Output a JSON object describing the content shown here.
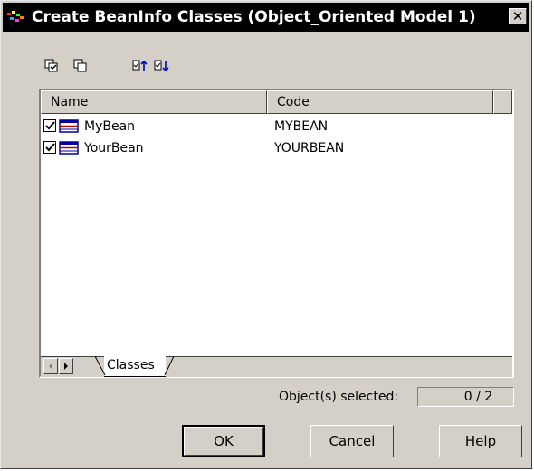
{
  "window": {
    "title": "Create BeanInfo Classes (Object_Oriented Model 1)",
    "close_symbol": "✕"
  },
  "toolbar": {
    "icons": [
      "select-all-icon",
      "deselect-all-icon",
      "use-graphical-selection-icon",
      "move-to-bottom-icon"
    ]
  },
  "list": {
    "columns": [
      "Name",
      "Code"
    ],
    "rows": [
      {
        "checked": true,
        "name": "MyBean",
        "code": "MYBEAN"
      },
      {
        "checked": true,
        "name": "YourBean",
        "code": "YOURBEAN"
      }
    ]
  },
  "tabs": {
    "active": "Classes"
  },
  "status": {
    "label": "Object(s) selected:",
    "value": "0 / 2"
  },
  "buttons": {
    "ok": "OK",
    "cancel": "Cancel",
    "help": "Help"
  }
}
